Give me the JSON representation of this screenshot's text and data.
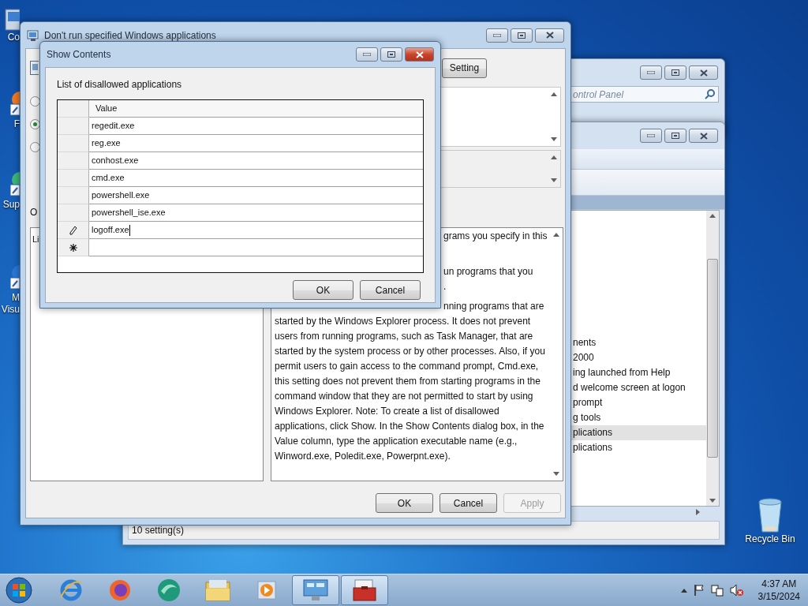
{
  "desktop": {
    "icons": [
      {
        "kind": "computer",
        "label": "Co"
      },
      {
        "kind": "shortcut-orange",
        "label": "F"
      },
      {
        "kind": "shortcut-green",
        "label": "Sup"
      },
      {
        "kind": "shortcut-blue",
        "label": "M Visu"
      }
    ],
    "recycle_bin": {
      "label": "Recycle Bin"
    }
  },
  "control_panel_window": {
    "search": {
      "placeholder": "ontrol Panel"
    }
  },
  "policy_editor": {
    "settings": [
      {
        "text": "nents",
        "selected": false
      },
      {
        "text": "2000",
        "selected": false
      },
      {
        "text": "ing launched from Help",
        "selected": false
      },
      {
        "text": "d welcome screen at logon",
        "selected": false
      },
      {
        "text": "prompt",
        "selected": false
      },
      {
        "text": "g tools",
        "selected": false
      },
      {
        "text": "plications",
        "selected": true
      },
      {
        "text": "plications",
        "selected": false
      }
    ],
    "status_bar": "10 setting(s)"
  },
  "policy_dialog": {
    "title": "Don't run specified Windows applications",
    "radios": [
      {
        "selected": false
      },
      {
        "selected": true
      },
      {
        "selected": false
      }
    ],
    "setting_button": "Setting",
    "options_label": "O",
    "options_text": "Li",
    "help_paragraphs": [
      [
        {
          "kind": "partial",
          "text": "grams you specify in this"
        }
      ],
      [
        {
          "kind": "partial",
          "text": "un programs that you"
        },
        {
          "kind": "partial",
          "text": "."
        }
      ],
      [
        {
          "kind": "partial",
          "text": "nning programs that are"
        },
        {
          "kind": "full",
          "text": "started by the Windows Explorer process. It does not prevent"
        },
        {
          "kind": "full",
          "text": "users from running programs, such as Task Manager, that are"
        },
        {
          "kind": "full",
          "text": "started by the system process or by other processes. Also, if you"
        },
        {
          "kind": "full",
          "text": "permit users to gain access to the command prompt, Cmd.exe,"
        },
        {
          "kind": "full",
          "text": "this setting does not prevent them from starting programs in the"
        },
        {
          "kind": "full",
          "text": "command window that they are not permitted to start by using"
        },
        {
          "kind": "full",
          "text": "Windows Explorer. Note: To create a list of disallowed"
        },
        {
          "kind": "full",
          "text": "applications, click Show. In the Show Contents dialog box, in the"
        },
        {
          "kind": "full",
          "text": "Value column, type the application executable name (e.g.,"
        },
        {
          "kind": "full",
          "text": "Winword.exe, Poledit.exe, Powerpnt.exe)."
        }
      ]
    ],
    "buttons": [
      {
        "label": "OK",
        "disabled": false
      },
      {
        "label": "Cancel",
        "disabled": false
      },
      {
        "label": "Apply",
        "disabled": true
      }
    ]
  },
  "show_contents": {
    "title": "Show Contents",
    "label": "List of disallowed applications",
    "column": "Value",
    "rows": [
      {
        "value": "regedit.exe",
        "editing": false
      },
      {
        "value": "reg.exe",
        "editing": false
      },
      {
        "value": "conhost.exe",
        "editing": false
      },
      {
        "value": "cmd.exe",
        "editing": false
      },
      {
        "value": "powershell.exe",
        "editing": false
      },
      {
        "value": "powershell_ise.exe",
        "editing": false
      },
      {
        "value": "logoff.exe",
        "editing": true
      }
    ],
    "buttons": [
      {
        "label": "OK"
      },
      {
        "label": "Cancel"
      }
    ]
  },
  "taskbar": {
    "apps": [
      {
        "kind": "ie",
        "active": false
      },
      {
        "kind": "firefox",
        "active": false
      },
      {
        "kind": "green",
        "active": false
      },
      {
        "kind": "explorer",
        "active": false
      },
      {
        "kind": "media",
        "active": false
      },
      {
        "kind": "control",
        "active": true
      },
      {
        "kind": "toolbox",
        "active": true
      }
    ],
    "clock": {
      "time": "4:37 AM",
      "date": "3/15/2024"
    }
  }
}
